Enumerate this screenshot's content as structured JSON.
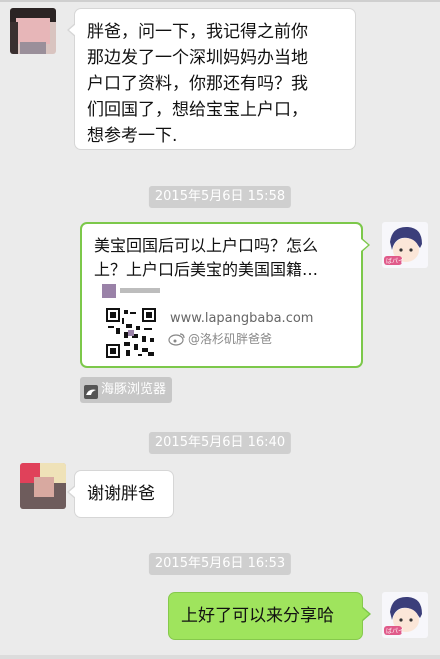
{
  "messages": [
    {
      "side": "left",
      "text": "胖爸，问一下，我记得之前你那边发了一个深圳妈妈办当地户口了资料，你那还有吗？我们回国了，想给宝宝上户口，想参考一下."
    },
    {
      "side": "right",
      "type": "link-card",
      "title": "美宝回国后可以上户口吗？怎么上？上户口后美宝的美国国籍…",
      "url": "www.lapangbaba.com",
      "weibo": "@洛杉矶胖爸爸",
      "source": "海豚浏览器"
    },
    {
      "side": "left",
      "text": "谢谢胖爸"
    },
    {
      "side": "right",
      "text": "上好了可以来分享哈"
    }
  ],
  "timestamps": [
    "2015年5月6日 15:58",
    "2015年5月6日 16:40",
    "2015年5月6日 16:53"
  ],
  "card_lines": [
    "美宝回国后可以上户口吗？怎么",
    "上？上户口后美宝的美国国籍…"
  ],
  "msg1_lines": [
    "胖爸，问一下，我记得之前你",
    "那边发了一个深圳妈妈办当地",
    "户口了资料，你那还有吗？我",
    "们回国了，想给宝宝上户口，",
    "想参考一下."
  ],
  "colors": {
    "background": "#ebebeb",
    "bubble_green": "#9fe45d",
    "bubble_white": "#ffffff"
  },
  "icons": [
    "dolphin-browser-icon",
    "weibo-icon",
    "qr-code"
  ]
}
